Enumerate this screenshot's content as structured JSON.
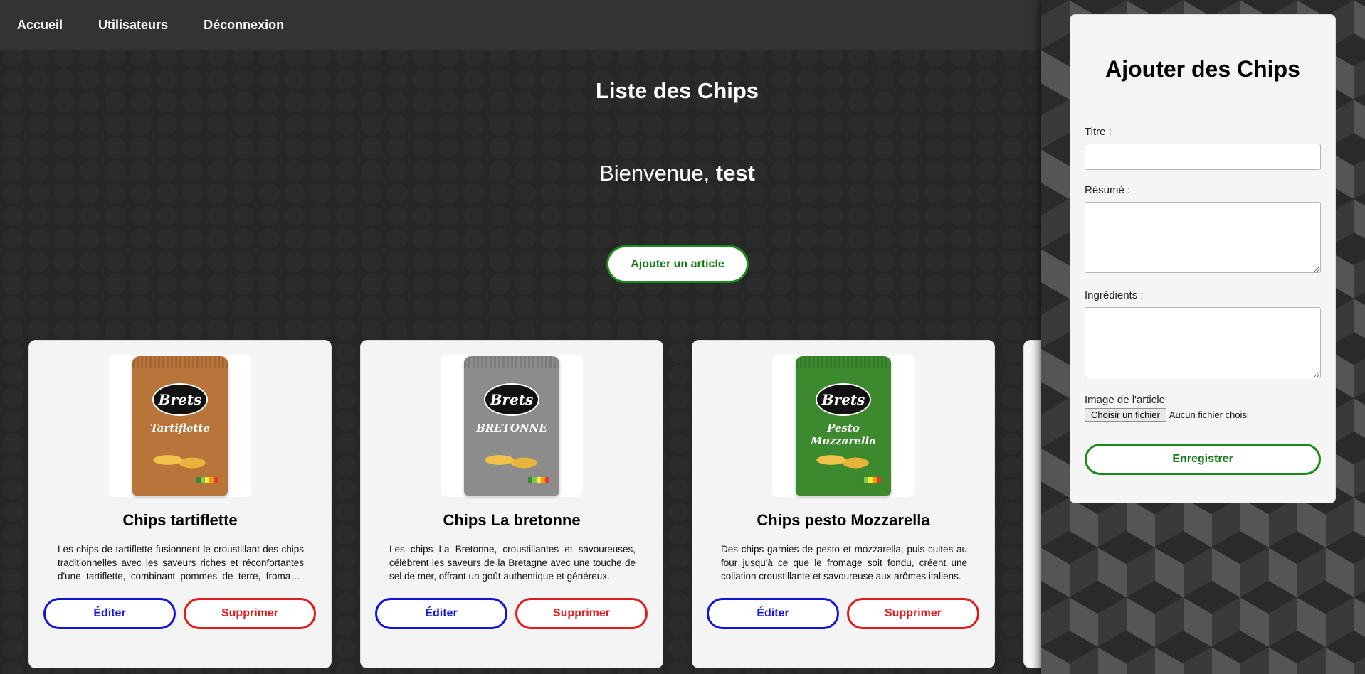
{
  "nav": {
    "items": [
      "Accueil",
      "Utilisateurs",
      "Déconnexion"
    ]
  },
  "main": {
    "title": "Liste des Chips",
    "welcome_prefix": "Bienvenue,",
    "username": "test",
    "add_button": "Ajouter un article"
  },
  "cards": [
    {
      "title": "Chips tartiflette",
      "description": "Les chips de tartiflette fusionnent le croustillant des chips traditionnelles avec les saveurs riches et réconfortantes d'une tartiflette, combinant pommes de terre, fromage, lardons et oignons.",
      "edit_label": "Éditer",
      "delete_label": "Supprimer",
      "bag_brand": "Brets",
      "bag_flavor": "Tartiflette",
      "bag_color": "#b9743a"
    },
    {
      "title": "Chips La bretonne",
      "description": "Les chips La Bretonne, croustillantes et savoureuses, célèbrent les saveurs de la Bretagne avec une touche de sel de mer, offrant un goût authentique et généreux.",
      "edit_label": "Éditer",
      "delete_label": "Supprimer",
      "bag_brand": "Brets",
      "bag_flavor": "BRETONNE",
      "bag_color": "#8c8c8c"
    },
    {
      "title": "Chips pesto Mozzarella",
      "description": "Des chips garnies de pesto et mozzarella, puis cuites au four jusqu'à ce que le fromage soit fondu, créent une collation croustillante et savoureuse aux arômes italiens.",
      "edit_label": "Éditer",
      "delete_label": "Supprimer",
      "bag_brand": "Brets",
      "bag_flavor": "Pesto Mozzarella",
      "bag_color": "#3d8a2e"
    }
  ],
  "form": {
    "title": "Ajouter des Chips",
    "title_label": "Titre :",
    "summary_label": "Résumé :",
    "ingredients_label": "Ingrédients :",
    "image_label": "Image de l'article",
    "file_button": "Choisir un fichier",
    "file_status": "Aucun fichier choisi",
    "save_button": "Enregistrer"
  },
  "colors": {
    "accent_green": "#1b8a1b",
    "edit_blue": "#1313d6",
    "delete_red": "#e01b1b",
    "navbar": "#333333"
  }
}
